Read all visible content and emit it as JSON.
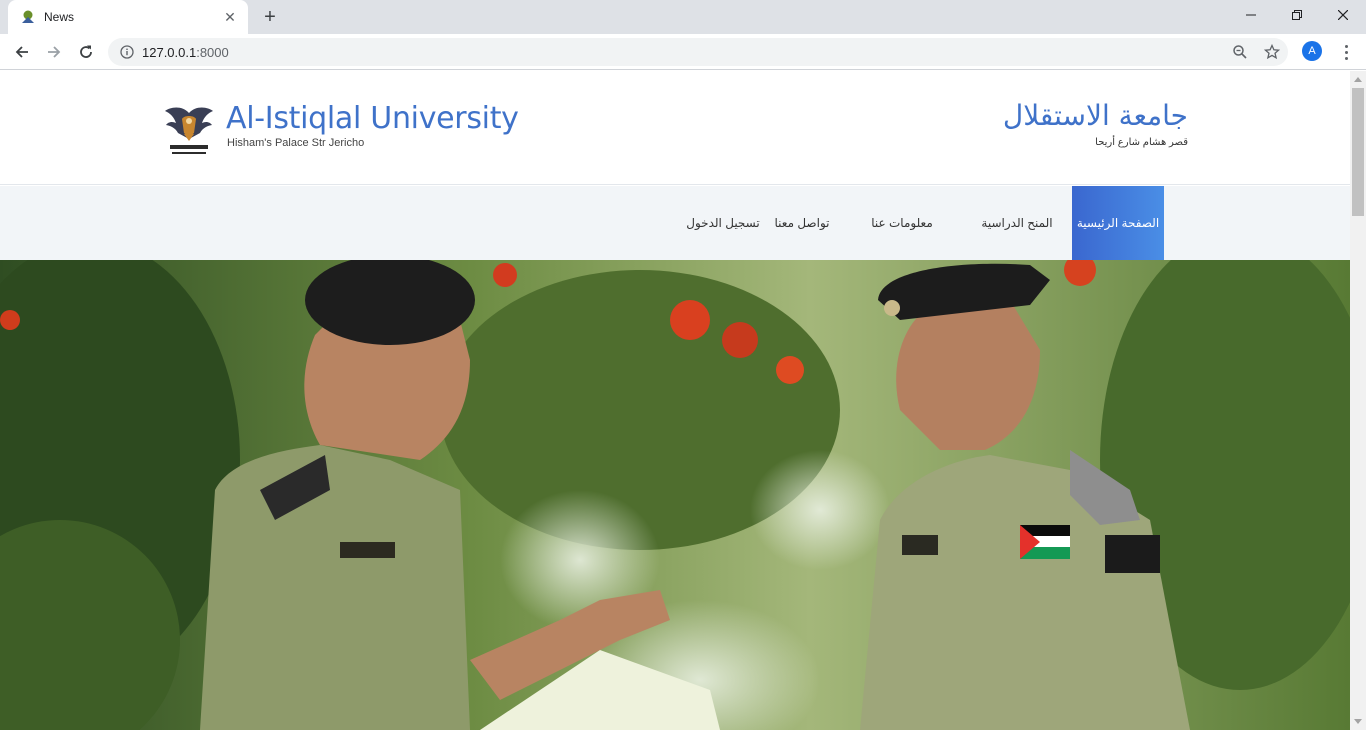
{
  "browser": {
    "tab_title": "News",
    "url_host": "127.0.0.1",
    "url_port": ":8000",
    "profile_initial": "A"
  },
  "header": {
    "title_en": "Al-Istiqlal University",
    "subtitle_en": "Hisham's Palace Str Jericho",
    "title_ar": "جامعة الاستقلال",
    "subtitle_ar": "قصر هشام شارع أريحا"
  },
  "nav": {
    "items": [
      {
        "label": "الصفحة الرئيسية",
        "active": true
      },
      {
        "label": "المنح الدراسية",
        "active": false
      },
      {
        "label": "معلومات عنا",
        "active": false
      },
      {
        "label": "تواصل معنا",
        "active": false
      },
      {
        "label": "تسجيل الدخول",
        "active": false
      }
    ]
  },
  "colors": {
    "brand": "#3f72c9",
    "nav_active_start": "#3a67cf",
    "nav_active_end": "#4a8ee6",
    "nav_bg": "#f2f5f8"
  }
}
